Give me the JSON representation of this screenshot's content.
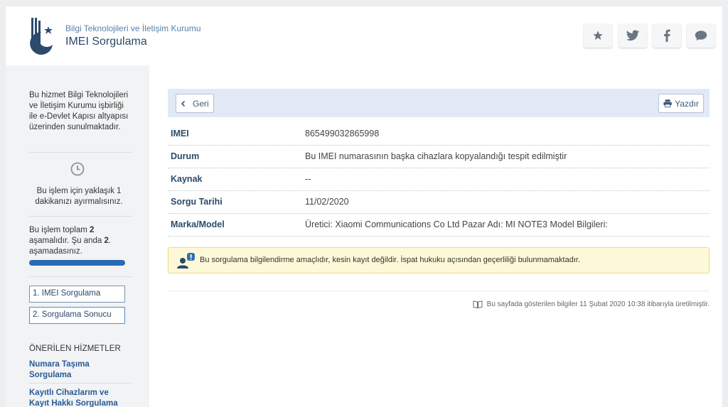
{
  "header": {
    "org_name": "Bilgi Teknolojileri ve İletişim Kurumu",
    "service_title": "IMEI Sorgulama",
    "share_icons": [
      "star-icon",
      "twitter-icon",
      "facebook-icon",
      "comment-icon"
    ]
  },
  "sidebar": {
    "intro": "Bu hizmet Bilgi Teknolojileri ve İletişim Kurumu işbirliği ile e-Devlet Kapısı altyapısı üzerinden sunulmaktadır.",
    "time_note": "Bu işlem için yaklaşık 1 dakikanızı ayırmalısınız.",
    "stage_note": {
      "prefix": "Bu işlem toplam ",
      "total": "2",
      "mid": " aşamalıdır. Şu anda ",
      "current": "2",
      "suffix": ". aşamadasınız."
    },
    "progress": 1.0,
    "steps": [
      "1. IMEI Sorgulama",
      "2. Sorgulama Sonucu"
    ],
    "recommended_title": "ÖNERİLEN HİZMETLER",
    "recommended": [
      "Numara Taşıma Sorgulama",
      "Kayıtlı Cihazlarım ve Kayıt Hakkı Sorgulama"
    ]
  },
  "toolbar": {
    "back_label": "Geri",
    "print_label": "Yazdır"
  },
  "result": [
    {
      "label": "IMEI",
      "value": "865499032865998"
    },
    {
      "label": "Durum",
      "value": "Bu IMEI numarasının başka cihazlara kopyalandığı tespit edilmiştir"
    },
    {
      "label": "Kaynak",
      "value": "--"
    },
    {
      "label": "Sorgu Tarihi",
      "value": "11/02/2020"
    },
    {
      "label": "Marka/Model",
      "value": "Üretici: Xiaomi Communications Co Ltd Pazar Adı: MI NOTE3 Model Bilgileri:"
    }
  ],
  "notice": "Bu sorgulama bilgilendirme amaçlıdır, kesin kayıt değildir. İspat hukuku açısından geçerliliği bulunmamaktadır.",
  "footnote": "Bu sayfada gösterilen bilgiler 11 Şubat 2020 10:38 itibarıyla üretilmiştir.",
  "colors": {
    "brand": "#2c4a6b",
    "accent": "#2a6ab2",
    "notice_bg": "#fdf9d8"
  }
}
